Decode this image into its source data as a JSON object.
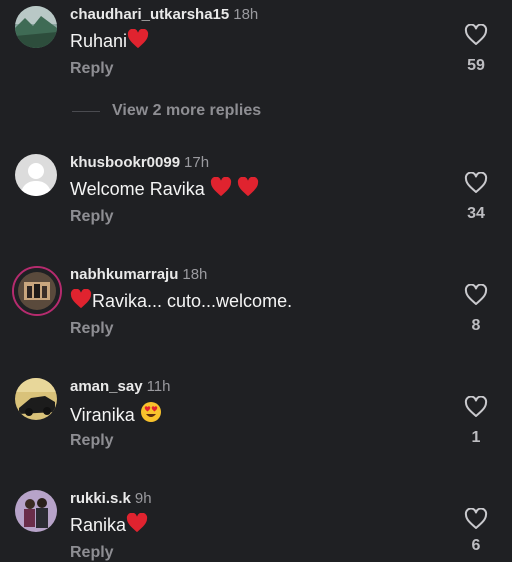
{
  "comments": [
    {
      "username": "chaudhari_utkarsha15",
      "time": "18h",
      "text": "Ruhani",
      "reply": "Reply",
      "likes": "59",
      "emojis": [
        "red-heart"
      ]
    },
    {
      "username": "khusbookr0099",
      "time": "17h",
      "text": "Welcome Ravika",
      "reply": "Reply",
      "likes": "34",
      "emojis": [
        "red-heart",
        "red-heart"
      ]
    },
    {
      "username": "nabhkumarraju",
      "time": "18h",
      "text": "Ravika... cuto...welcome.",
      "reply": "Reply",
      "likes": "8",
      "emojis": [
        "red-heart"
      ]
    },
    {
      "username": "aman_say",
      "time": "11h",
      "text": "Viranika",
      "reply": "Reply",
      "likes": "1",
      "emojis": [
        "heart-eyes-face"
      ]
    },
    {
      "username": "rukki.s.k",
      "time": "9h",
      "text": "Ranika",
      "reply": "Reply",
      "likes": "6",
      "emojis": [
        "red-heart"
      ]
    }
  ],
  "more_replies": "View 2 more replies",
  "colors": {
    "background": "#1f2023",
    "secondary": "#8e8e93",
    "heart": "#e0232f"
  }
}
